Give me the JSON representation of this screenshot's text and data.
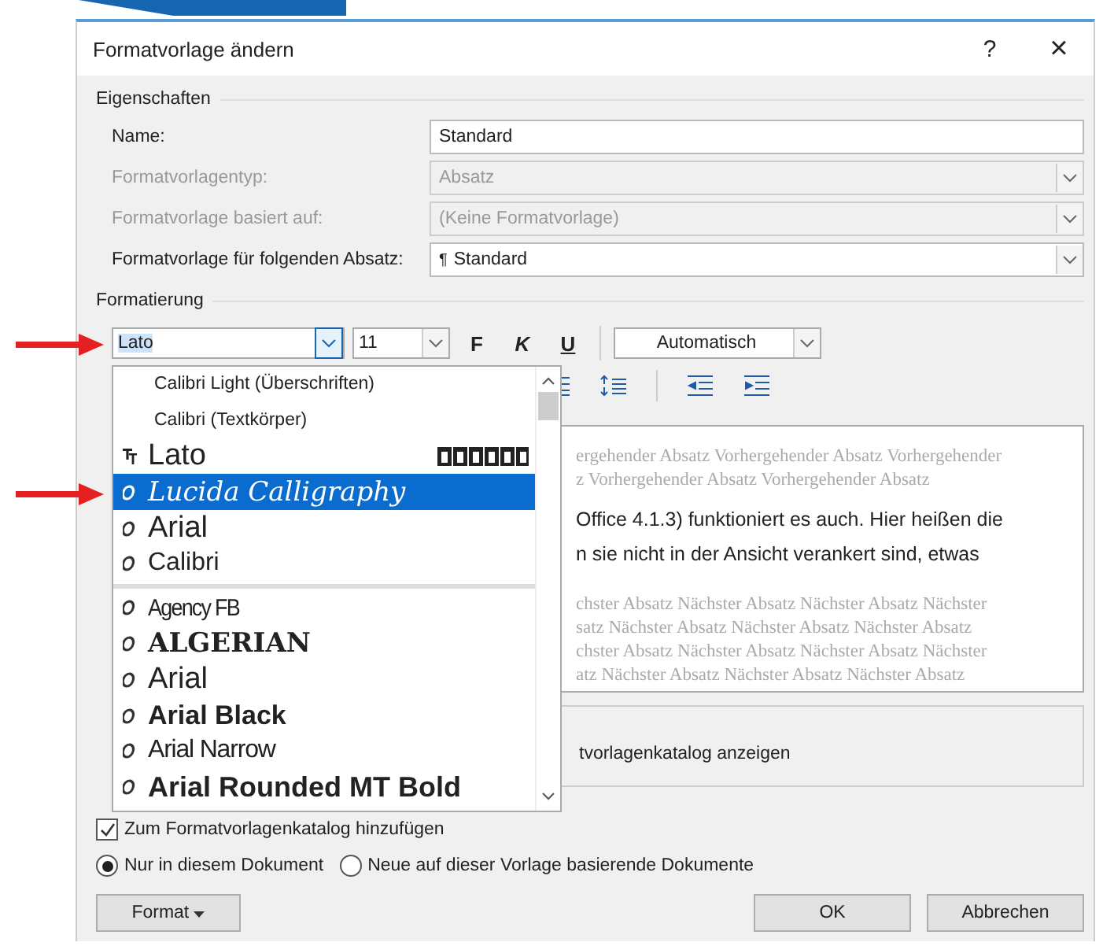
{
  "window": {
    "title": "Formatvorlage ändern",
    "help": "?",
    "close": "×"
  },
  "properties": {
    "heading": "Eigenschaften",
    "fields": [
      {
        "label": "Name:",
        "value": "Standard",
        "kind": "text",
        "disabled": false
      },
      {
        "label": "Formatvorlagentyp:",
        "value": "Absatz",
        "kind": "select",
        "disabled": true
      },
      {
        "label": "Formatvorlage basiert auf:",
        "value": "(Keine Formatvorlage)",
        "kind": "select",
        "disabled": true
      },
      {
        "label": "Formatvorlage für folgenden Absatz:",
        "mark": "¶",
        "value": "Standard",
        "kind": "select",
        "disabled": false
      }
    ]
  },
  "formatting": {
    "heading": "Formatierung",
    "font": "Lato",
    "size": "11",
    "styles": [
      {
        "label": "F",
        "kind": "bold"
      },
      {
        "label": "K",
        "kind": "italic"
      },
      {
        "label": "U",
        "kind": "underline"
      }
    ],
    "color_box": {
      "value": "Automatisch"
    }
  },
  "preview": {
    "lines": [
      {
        "text": "ergehender Absatz Vorhergehender Absatz Vorhergehender",
        "kind": "sample"
      },
      {
        "text": "z Vorhergehender Absatz Vorhergehender Absatz",
        "kind": "sample"
      },
      {
        "text": "Office 4.1.3) funktioniert es auch. Hier heißen die",
        "kind": "current"
      },
      {
        "text": "n sie nicht in der Ansicht verankert sind, etwas",
        "kind": "current"
      },
      {
        "text": "chster Absatz Nächster Absatz Nächster Absatz Nächster",
        "kind": "sample"
      },
      {
        "text": "satz Nächster Absatz Nächster Absatz Nächster Absatz",
        "kind": "sample"
      },
      {
        "text": "chster Absatz Nächster Absatz Nächster Absatz Nächster",
        "kind": "sample"
      },
      {
        "text": "atz Nächster Absatz Nächster Absatz Nächster Absatz",
        "kind": "sample"
      }
    ]
  },
  "description": {
    "text": "tvorlagenkatalog anzeigen"
  },
  "font_dropdown": {
    "theme_fonts": [
      {
        "label": "Calibri Light (Überschriften)",
        "selected": false
      },
      {
        "label": "Calibri (Textkörper)",
        "selected": false
      }
    ],
    "recent_fonts": [
      {
        "label": "Lato",
        "kind": "truetype",
        "selected": false,
        "sample": true
      },
      {
        "label": "Lucida Calligraphy",
        "kind": "opentype",
        "selected": true
      },
      {
        "label": "Arial",
        "kind": "opentype",
        "selected": false
      },
      {
        "label": "Calibri",
        "kind": "opentype",
        "selected": false
      }
    ],
    "all_fonts": [
      {
        "label": "Agency FB",
        "kind": "opentype",
        "selected": false
      },
      {
        "label": "ALGERIAN",
        "kind": "opentype",
        "selected": false
      },
      {
        "label": "Arial",
        "kind": "opentype",
        "selected": false
      },
      {
        "label": "Arial Black",
        "kind": "opentype",
        "selected": false
      },
      {
        "label": "Arial Narrow",
        "kind": "opentype",
        "selected": false
      },
      {
        "label": "Arial Rounded MT Bold",
        "kind": "opentype",
        "selected": false
      }
    ]
  },
  "options": {
    "add_to_gallery": {
      "label": "Zum Formatvorlagenkatalog hinzufügen",
      "checked": true
    },
    "scope": [
      {
        "label": "Nur in diesem Dokument",
        "selected": true
      },
      {
        "label": "Neue auf dieser Vorlage basierende Dokumente",
        "selected": false
      }
    ]
  },
  "buttons": [
    {
      "label": "Format",
      "kind": "menu"
    },
    {
      "label": "OK",
      "kind": "plain"
    },
    {
      "label": "Abbrechen",
      "kind": "plain"
    }
  ]
}
